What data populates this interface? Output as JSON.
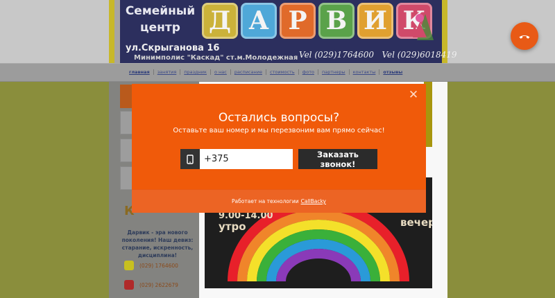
{
  "header": {
    "title_line1": "Семейный",
    "title_line2": "центр",
    "logo_letters": [
      "Д",
      "А",
      "Р",
      "В",
      "И",
      "К"
    ],
    "logo_colors": [
      "#cbb23a",
      "#4fa8d8",
      "#e06a2a",
      "#5aa24a",
      "#e0a030",
      "#d04a6a"
    ],
    "address": "ул.Скрыганова 16",
    "subaddress": "Минимполис \"Каскад\" ст.м.Молодежная",
    "phone1": "Vel (029)1764600",
    "phone2": "Vel (029)6018419"
  },
  "nav": {
    "items": [
      "главная",
      "занятия",
      "праздник",
      "о нас",
      "расписание",
      "стоимость",
      "фото",
      "партнеры",
      "контакты",
      "отзывы"
    ]
  },
  "sidebar": {
    "letter": "К",
    "slogan": "Дарвик - эра нового поколения! Наш девиз: старание, искренность, дисциплина!",
    "contacts": [
      {
        "icon": "velcom-icon",
        "phone": "(029) 1764600"
      },
      {
        "icon": "mts-icon",
        "phone": "(029) 2622679"
      }
    ]
  },
  "banner": {
    "time_left": "9.00-14.00",
    "label_left": "утро",
    "label_right": "вечер"
  },
  "modal": {
    "title": "Остались вопросы?",
    "subtitle": "Оставьте ваш номер и мы перезвоним вам прямо сейчас!",
    "phone_value": "+375",
    "button_label": "Заказать звонок!",
    "footer_text": "Работает на технологии",
    "footer_link": "CallBacky",
    "close_symbol": "✕"
  },
  "colors": {
    "modal_bg": "#f05a0a",
    "button_bg": "#2b2b2b",
    "fab_bg": "#e85a16"
  }
}
